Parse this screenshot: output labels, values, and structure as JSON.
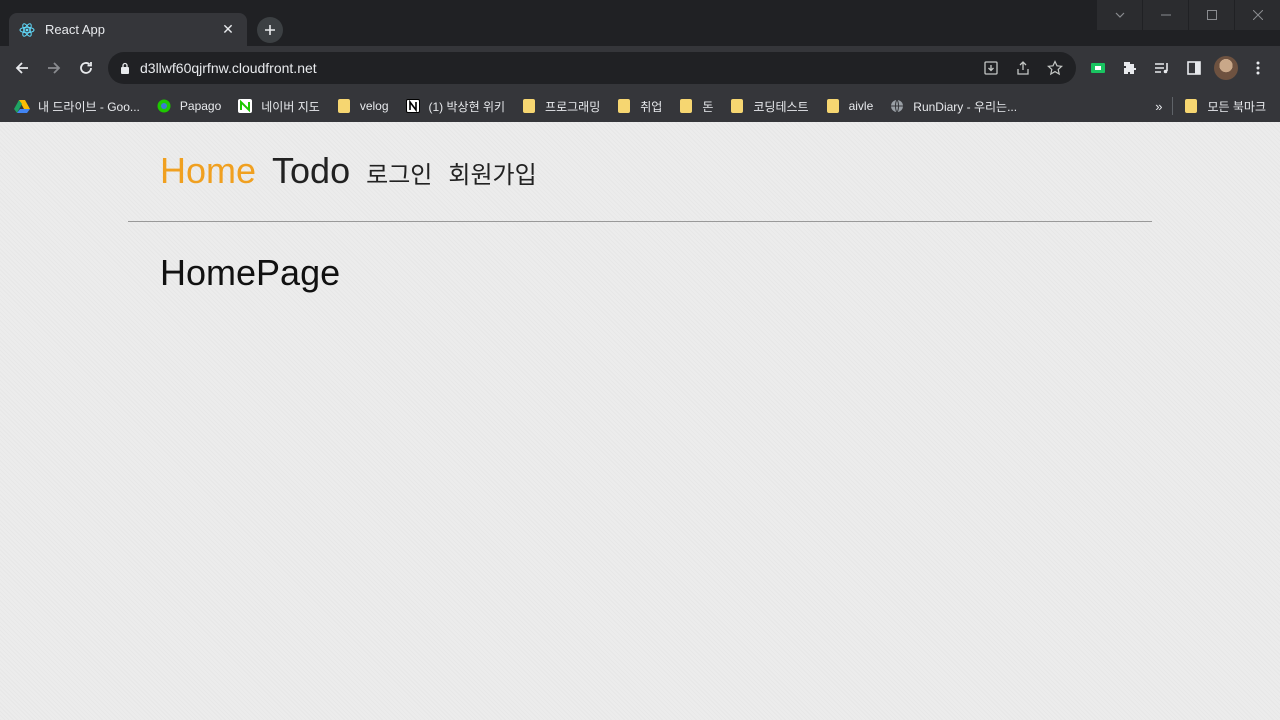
{
  "browser": {
    "tab": {
      "title": "React App"
    },
    "address_bar": {
      "url": "d3llwf60qjrfnw.cloudfront.net"
    },
    "bookmarks": [
      {
        "label": "내 드라이브 - Goo...",
        "icon": "google-drive-icon"
      },
      {
        "label": "Papago",
        "icon": "papago-icon"
      },
      {
        "label": "네이버 지도",
        "icon": "naver-map-icon"
      },
      {
        "label": "velog",
        "icon": "folder-icon"
      },
      {
        "label": "(1) 박상현 위키",
        "icon": "notion-icon"
      },
      {
        "label": "프로그래밍",
        "icon": "folder-icon"
      },
      {
        "label": "취업",
        "icon": "folder-icon"
      },
      {
        "label": "돈",
        "icon": "folder-icon"
      },
      {
        "label": "코딩테스트",
        "icon": "folder-icon"
      },
      {
        "label": "aivle",
        "icon": "folder-icon"
      },
      {
        "label": "RunDiary - 우리는...",
        "icon": "globe-icon"
      }
    ],
    "bookmarks_overflow": "»",
    "all_bookmarks": "모든 북마크"
  },
  "app": {
    "nav": {
      "home": "Home",
      "todo": "Todo",
      "login": "로그인",
      "signup": "회원가입"
    },
    "active_color": "#f0a020",
    "page_title": "HomePage"
  }
}
